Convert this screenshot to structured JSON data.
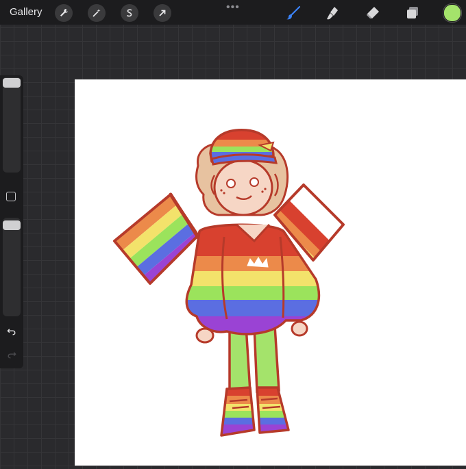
{
  "toolbar": {
    "gallery_label": "Gallery",
    "actions_icon": "wrench-icon",
    "adjustments_icon": "magic-wand-icon",
    "selection_icon": "selection-s-icon",
    "transform_icon": "arrow-icon",
    "more_icon": "more-dots-icon",
    "brush_icon": "brush-icon",
    "smudge_icon": "smudge-icon",
    "eraser_icon": "eraser-icon",
    "layers_icon": "layers-icon",
    "current_color": "#a4e36b"
  },
  "sidebar": {
    "size_slider_level": 0.0,
    "opacity_slider_level": 0.0,
    "modify_icon": "square-icon",
    "undo_icon": "undo-icon",
    "redo_icon": "redo-icon"
  },
  "canvas": {
    "artwork": "rainbow-pride-character-drawing"
  },
  "colors": {
    "topbar_bg": "#1c1c1e",
    "brush_active": "#3b82f6",
    "canvas_bg": "#ffffff",
    "outline": "#b63a2a",
    "red": "#d8412f",
    "orange": "#ec8a4a",
    "yellow": "#f3e26b",
    "green": "#9be35c",
    "blue": "#5b6ee1",
    "purple": "#9a43d4"
  }
}
